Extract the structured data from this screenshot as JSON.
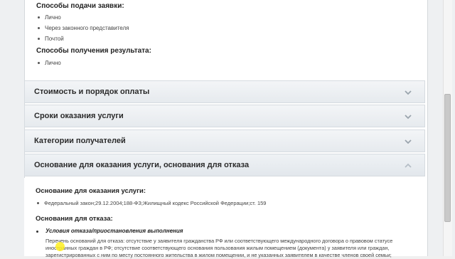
{
  "submission": {
    "heading": "Способы подачи заявки:",
    "items": [
      "Лично",
      "Через законного представителя",
      "Почтой"
    ]
  },
  "result": {
    "heading": "Способы получения результата:",
    "items": [
      "Лично"
    ]
  },
  "accordions": [
    {
      "title": "Стоимость и порядок оплаты",
      "state": "collapsed"
    },
    {
      "title": "Сроки оказания услуги",
      "state": "collapsed"
    },
    {
      "title": "Категории получателей",
      "state": "collapsed"
    },
    {
      "title": "Основание для оказания услуги, основания для отказа",
      "state": "expanded"
    }
  ],
  "basis": {
    "heading": "Основание для оказания услуги:",
    "item": "Федеральный закон;29.12.2004;188-ФЗ;Жилищный кодекс Российской Федерации;ст. 159"
  },
  "refusal": {
    "heading": "Основания для отказа:",
    "condition_heading": "Условия отказа/приостановления выполнения",
    "text": "Перечень оснований для отказа: отсутствие у заявителя гражданства РФ или соответствующего международного договора о правовом статусе иностранных граждан в РФ; отсутствие соответствующего основания пользования жилым помещением (документа) у заявителя или граждан, зарегистрированных с ним по месту постоянного жительства в жилом помещении, и не указанных заявителем в качестве членов своей семьи;"
  },
  "colors": {
    "accordion_bg": "#e6eaee",
    "highlight": "#ffee1e"
  }
}
